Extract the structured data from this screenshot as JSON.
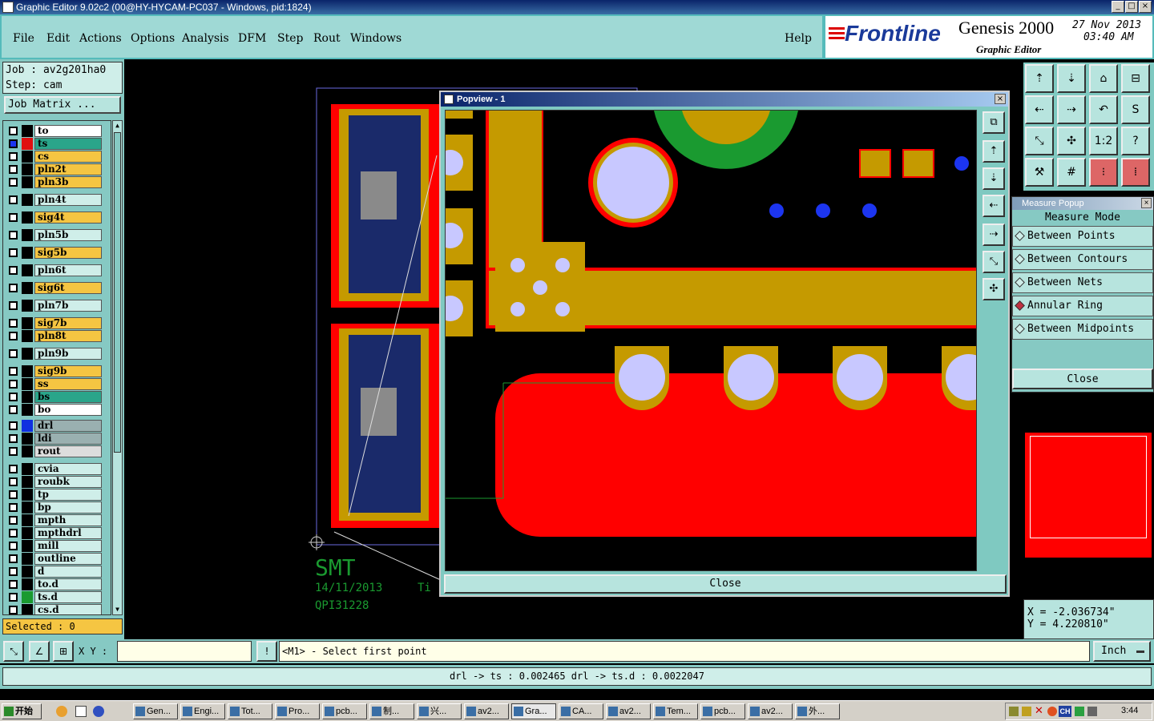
{
  "window": {
    "title": "Graphic Editor 9.02c2 (00@HY-HYCAM-PC037 - Windows, pid:1824)"
  },
  "menu": [
    "File",
    "Edit",
    "Actions",
    "Options",
    "Analysis",
    "DFM",
    "Step",
    "Rout",
    "Windows"
  ],
  "help_label": "Help",
  "brand": {
    "logo": "Frontline",
    "product": "Genesis 2000",
    "subtitle": "Graphic Editor",
    "date": "27 Nov 2013",
    "time": "03:40 AM"
  },
  "job": {
    "line1": "Job : av2g201ha0",
    "line2": "Step: cam",
    "matrix_button": "Job Matrix ..."
  },
  "layers": [
    {
      "name": "to",
      "color": "#ffffff",
      "swatch": ""
    },
    {
      "name": "ts",
      "color": "#2aa58a",
      "swatch": "#e01010",
      "active": true
    },
    {
      "name": "cs",
      "color": "#f5c542",
      "swatch": ""
    },
    {
      "name": "pln2t",
      "color": "#f5c542",
      "swatch": ""
    },
    {
      "name": "pln3b",
      "color": "#f5c542",
      "swatch": ""
    },
    {
      "name": "pln4t",
      "color": "#cfeee9",
      "swatch": ""
    },
    {
      "name": "sig4t",
      "color": "#f5c542",
      "swatch": ""
    },
    {
      "name": "pln5b",
      "color": "#cfeee9",
      "swatch": ""
    },
    {
      "name": "sig5b",
      "color": "#f5c542",
      "swatch": ""
    },
    {
      "name": "pln6t",
      "color": "#cfeee9",
      "swatch": ""
    },
    {
      "name": "sig6t",
      "color": "#f5c542",
      "swatch": ""
    },
    {
      "name": "pln7b",
      "color": "#cfeee9",
      "swatch": ""
    },
    {
      "name": "sig7b",
      "color": "#f5c542",
      "swatch": ""
    },
    {
      "name": "pln8t",
      "color": "#f5c542",
      "swatch": ""
    },
    {
      "name": "pln9b",
      "color": "#cfeee9",
      "swatch": ""
    },
    {
      "name": "sig9b",
      "color": "#f5c542",
      "swatch": ""
    },
    {
      "name": "ss",
      "color": "#f5c542",
      "swatch": ""
    },
    {
      "name": "bs",
      "color": "#2aa58a",
      "swatch": ""
    },
    {
      "name": "bo",
      "color": "#ffffff",
      "swatch": ""
    },
    {
      "name": "drl",
      "color": "#9ab0b0",
      "swatch": "#1030e0"
    },
    {
      "name": "ldi",
      "color": "#9ab0b0",
      "swatch": ""
    },
    {
      "name": "rout",
      "color": "#dddddd",
      "swatch": ""
    },
    {
      "name": "cvia",
      "color": "#cfeee9",
      "swatch": ""
    },
    {
      "name": "roubk",
      "color": "#cfeee9",
      "swatch": ""
    },
    {
      "name": "tp",
      "color": "#cfeee9",
      "swatch": ""
    },
    {
      "name": "bp",
      "color": "#cfeee9",
      "swatch": ""
    },
    {
      "name": "mpth",
      "color": "#cfeee9",
      "swatch": ""
    },
    {
      "name": "mpthdrl",
      "color": "#cfeee9",
      "swatch": ""
    },
    {
      "name": "mill",
      "color": "#cfeee9",
      "swatch": ""
    },
    {
      "name": "outline",
      "color": "#cfeee9",
      "swatch": ""
    },
    {
      "name": "d",
      "color": "#cfeee9",
      "swatch": ""
    },
    {
      "name": "to.d",
      "color": "#cfeee9",
      "swatch": ""
    },
    {
      "name": "ts.d",
      "color": "#cfeee9",
      "swatch": "#1a9a30"
    },
    {
      "name": "cs.d",
      "color": "#cfeee9",
      "swatch": ""
    }
  ],
  "selected": "Selected : 0",
  "canvas_text": {
    "smt": "SMT",
    "date": "14/11/2013",
    "ti": "Ti",
    "code": "QPI31228"
  },
  "popview": {
    "title": "Popview - 1",
    "close_label": "Close"
  },
  "measure": {
    "title": "Measure Popup",
    "heading": "Measure Mode",
    "modes": [
      "Between Points",
      "Between Contours",
      "Between Nets",
      "Annular Ring",
      "Between Midpoints"
    ],
    "active_mode": "Annular Ring",
    "close_label": "Close"
  },
  "coords": {
    "x": "X = -2.036734\"",
    "y": "Y = 4.220810\""
  },
  "command": {
    "xy_label": "X Y :",
    "xy_value": "",
    "prompt": "<M1> - Select first point",
    "units": "Inch"
  },
  "status": "drl -> ts : 0.002465    drl -> ts.d : 0.0022047",
  "taskbar": {
    "start": "开始",
    "tasks": [
      "Gen...",
      "Engi...",
      "Tot...",
      "Pro...",
      "pcb...",
      "制...",
      "兴...",
      "av2...",
      "Gra...",
      "CA...",
      "av2...",
      "Tem...",
      "pcb...",
      "av2...",
      "外..."
    ],
    "clock": "3:44",
    "tray_ch": "CH"
  },
  "colors": {
    "teal": "#86c9c3",
    "copper": "#c59a00",
    "mask_red": "#ff0000",
    "drill": "#c8c8ff",
    "via_blue": "#1c35f0"
  }
}
